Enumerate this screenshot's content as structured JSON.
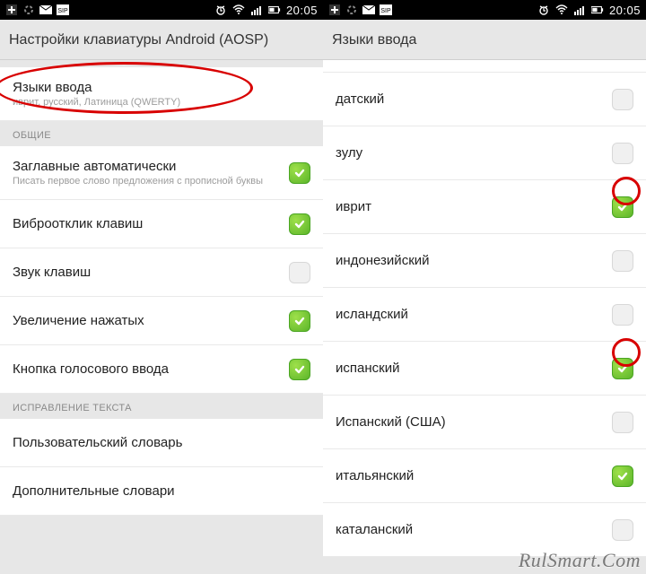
{
  "statusbar": {
    "time": "20:05"
  },
  "left": {
    "header": "Настройки клавиатуры Android (AOSP)",
    "input_languages": {
      "title": "Языки ввода",
      "subtitle": "иврит, русский, Латиница (QWERTY)"
    },
    "section_general": "ОБЩИЕ",
    "auto_caps": {
      "title": "Заглавные автоматически",
      "subtitle": "Писать первое слово предложения с прописной буквы"
    },
    "vibrate": {
      "title": "Виброотклик клавиш"
    },
    "sound": {
      "title": "Звук клавиш"
    },
    "popup": {
      "title": "Увеличение нажатых"
    },
    "voice_key": {
      "title": "Кнопка голосового ввода"
    },
    "section_correction": "ИСПРАВЛЕНИЕ ТЕКСТА",
    "user_dict": {
      "title": "Пользовательский словарь"
    },
    "addon_dict": {
      "title": "Дополнительные словари"
    }
  },
  "right": {
    "header": "Языки ввода",
    "langs": [
      {
        "label": "датский",
        "checked": false
      },
      {
        "label": "зулу",
        "checked": false
      },
      {
        "label": "иврит",
        "checked": true
      },
      {
        "label": "индонезийский",
        "checked": false
      },
      {
        "label": "исландский",
        "checked": false
      },
      {
        "label": "испанский",
        "checked": true
      },
      {
        "label": "Испанский (США)",
        "checked": false
      },
      {
        "label": "итальянский",
        "checked": true
      },
      {
        "label": "каталанский",
        "checked": false
      }
    ]
  },
  "watermark": "RulSmart.Com"
}
